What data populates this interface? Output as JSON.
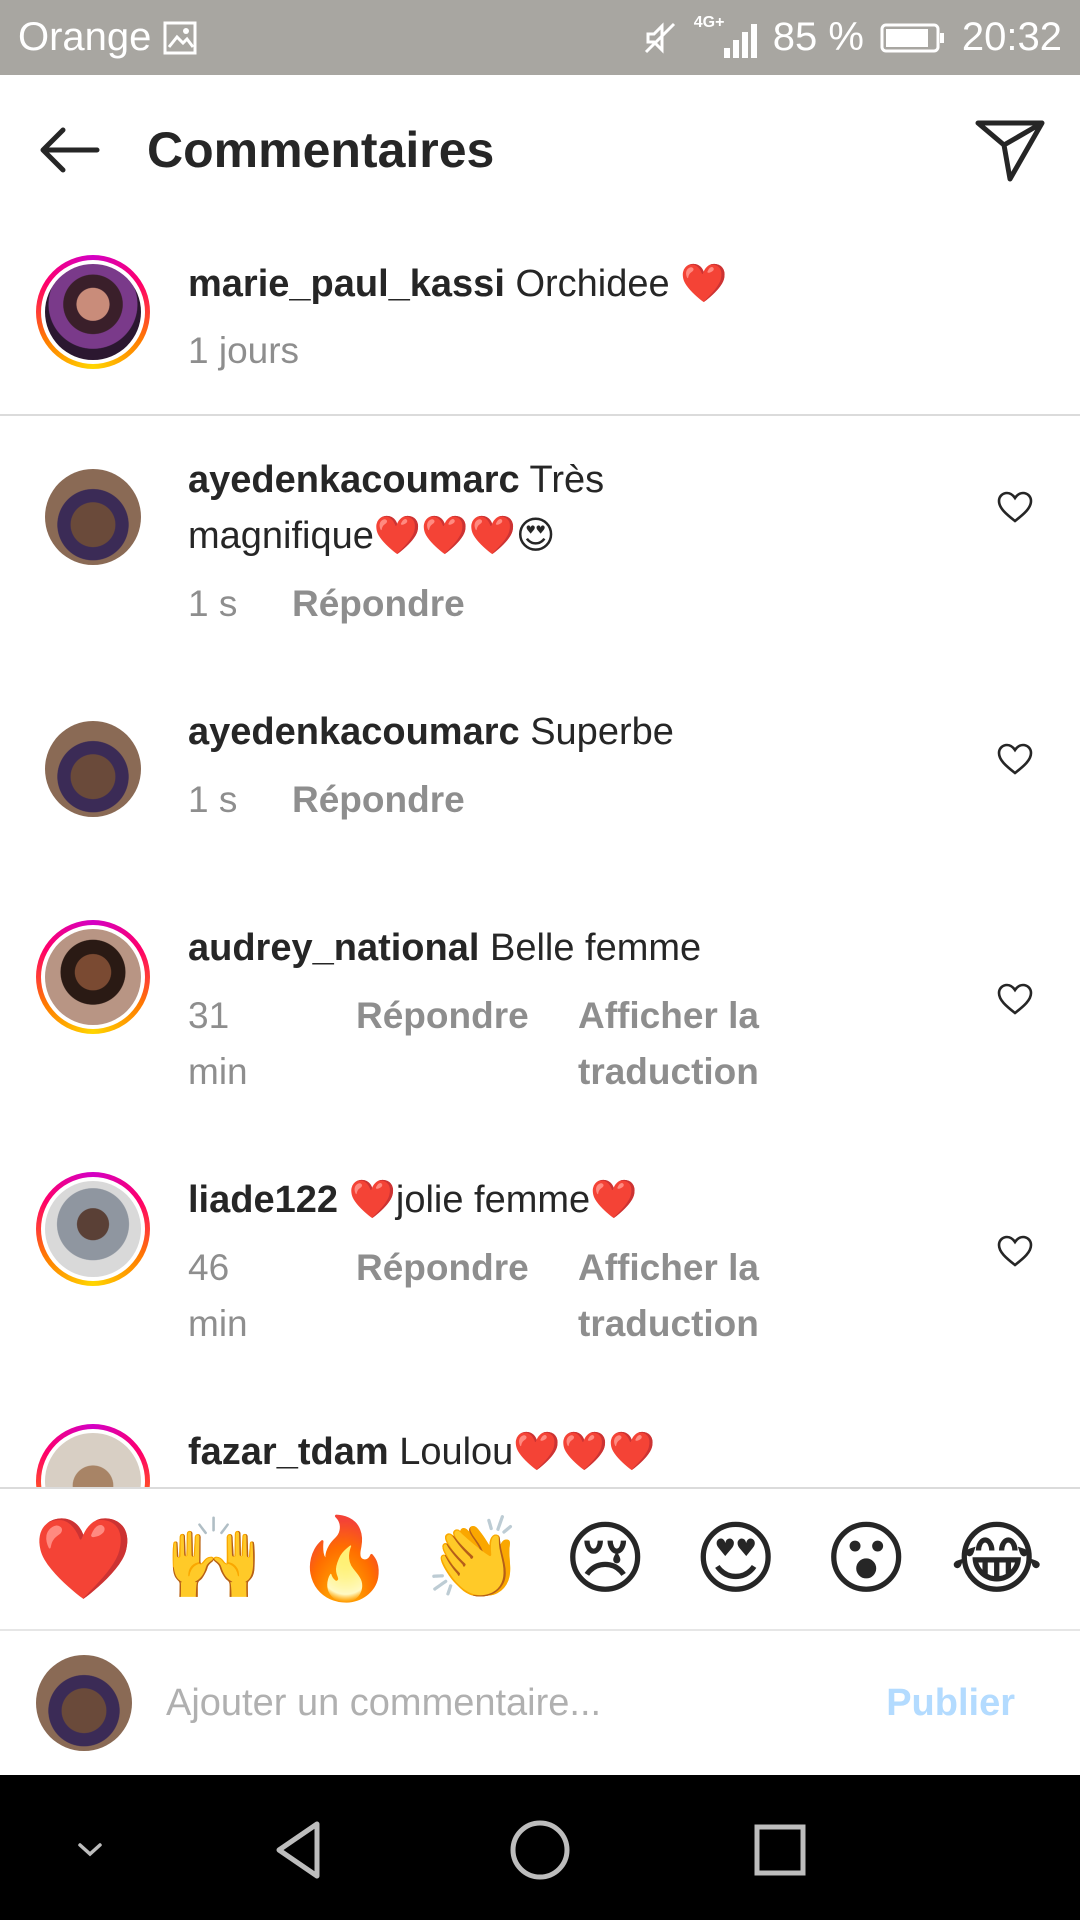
{
  "status_bar": {
    "carrier": "Orange",
    "network": "4G+",
    "battery": "85 %",
    "time": "20:32"
  },
  "header": {
    "title": "Commentaires"
  },
  "caption": {
    "username": "marie_paul_kassi",
    "text": "Orchidee ❤️",
    "time": "1 jours"
  },
  "comments": [
    {
      "username": "ayedenkacoumarc",
      "text": "Très magnifique❤️❤️❤️😍",
      "time": "1 s",
      "reply_label": "Répondre"
    },
    {
      "username": "ayedenkacoumarc",
      "text": "Superbe",
      "time": "1 s",
      "reply_label": "Répondre"
    },
    {
      "username": "audrey_national",
      "text": "Belle femme",
      "time": "31 min",
      "reply_label": "Répondre",
      "translate_label": "Afficher la traduction"
    },
    {
      "username": "liade122",
      "text": "❤️jolie femme❤️",
      "time": "46 min",
      "reply_label": "Répondre",
      "translate_label": "Afficher la traduction"
    },
    {
      "username": "fazar_tdam",
      "text": "Loulou❤️❤️❤️"
    }
  ],
  "emoji_bar": [
    "❤️",
    "🙌",
    "🔥",
    "👏",
    "😢",
    "😍",
    "😮",
    "😂"
  ],
  "composer": {
    "placeholder": "Ajouter un commentaire...",
    "publish_label": "Publier"
  },
  "colors": {
    "accent_disabled": "#b3dbff",
    "secondary_text": "#8e8e8e",
    "status_bar_bg": "#a8a6a1"
  }
}
